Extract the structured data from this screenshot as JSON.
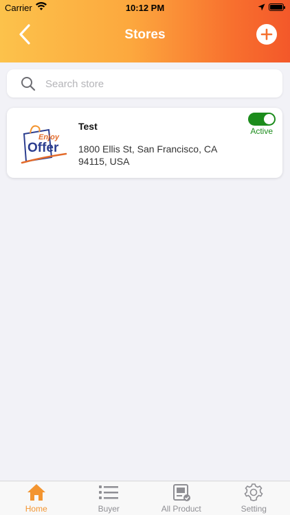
{
  "status_bar": {
    "carrier": "Carrier",
    "time": "10:12 PM"
  },
  "header": {
    "title": "Stores",
    "gradient": [
      "#fcc24b",
      "#f3582a"
    ]
  },
  "search": {
    "placeholder": "Search store",
    "value": ""
  },
  "stores": [
    {
      "name": "Test",
      "address": "1800 Ellis St, San Francisco, CA 94115, USA",
      "status": "Active",
      "active": true,
      "logo": {
        "top": "Enjoy",
        "bottom": "Offer"
      }
    }
  ],
  "tabs": [
    {
      "label": "Home",
      "icon": "home-icon",
      "active": true
    },
    {
      "label": "Buyer",
      "icon": "list-icon",
      "active": false
    },
    {
      "label": "All Product",
      "icon": "product-icon",
      "active": false
    },
    {
      "label": "Setting",
      "icon": "gear-icon",
      "active": false
    }
  ],
  "colors": {
    "accent": "#f39530",
    "active_green": "#1c8c1c",
    "inactive_tab": "#8e8e93"
  }
}
